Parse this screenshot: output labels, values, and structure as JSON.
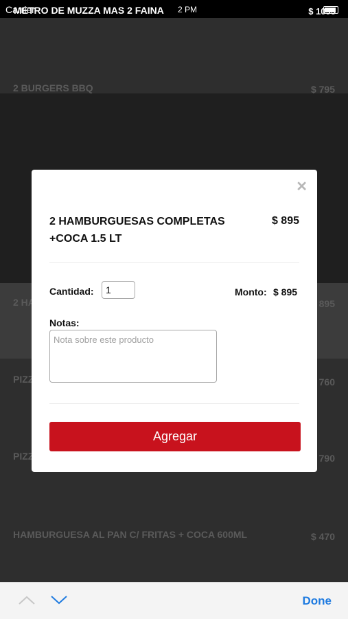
{
  "status_bar": {
    "carrier": "Carrier",
    "time": "2 PM"
  },
  "header": {
    "title": "METRO DE MUZZA MAS 2 FAINA",
    "price": "$ 1095"
  },
  "list": {
    "items": [
      {
        "title": "2 BURGERS BBQ",
        "price": "$ 795"
      },
      {
        "title": "2 HA",
        "price": "895"
      },
      {
        "title": "PIZZ",
        "price": "760"
      },
      {
        "title": "PIZZ",
        "price": "790"
      },
      {
        "title": "HAMBURGUESA AL PAN C/ FRITAS + COCA 600ML",
        "price": "$ 470"
      }
    ]
  },
  "modal": {
    "close_symbol": "✕",
    "product_title": "2 HAMBURGUESAS COMPLETAS +COCA 1.5 LT",
    "product_price": "$ 895",
    "quantity_label": "Cantidad:",
    "quantity_value": "1",
    "amount_label": "Monto:",
    "amount_value": "$ 895",
    "notes_label": "Notas:",
    "notes_placeholder": "Nota sobre este producto",
    "notes_value": "",
    "add_button": "Agregar",
    "accent_color": "#c8121d"
  },
  "accessory_bar": {
    "done_label": "Done",
    "prev_icon": "chevron-up-icon",
    "next_icon": "chevron-down-icon"
  }
}
